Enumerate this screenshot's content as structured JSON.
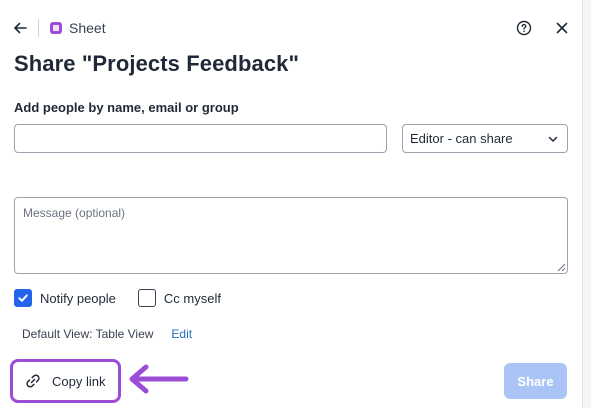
{
  "header": {
    "breadcrumb": "Sheet"
  },
  "dialog": {
    "title": "Share \"Projects Feedback\"",
    "add_people_label": "Add people by name, email or group",
    "people_input_value": "",
    "role_select_value": "Editor - can share",
    "message_placeholder": "Message (optional)",
    "message_value": ""
  },
  "options": {
    "notify_people_label": "Notify people",
    "notify_people_checked": true,
    "cc_myself_label": "Cc myself",
    "cc_myself_checked": false
  },
  "default_view": {
    "text": "Default View: Table View",
    "edit_label": "Edit"
  },
  "footer": {
    "copy_link_label": "Copy link",
    "share_label": "Share"
  },
  "colors": {
    "accent": "#2563eb",
    "share_disabled": "#a9c4f5",
    "highlight": "#9b4dd8",
    "link": "#1d6fb8"
  },
  "icons": {
    "back": "arrow-left-icon",
    "sheet": "sheet-icon",
    "help": "help-circle-icon",
    "close": "close-icon",
    "chevron": "chevron-down-icon",
    "link": "link-icon",
    "check": "check-icon",
    "annotation_arrow": "annotation-arrow-icon"
  }
}
